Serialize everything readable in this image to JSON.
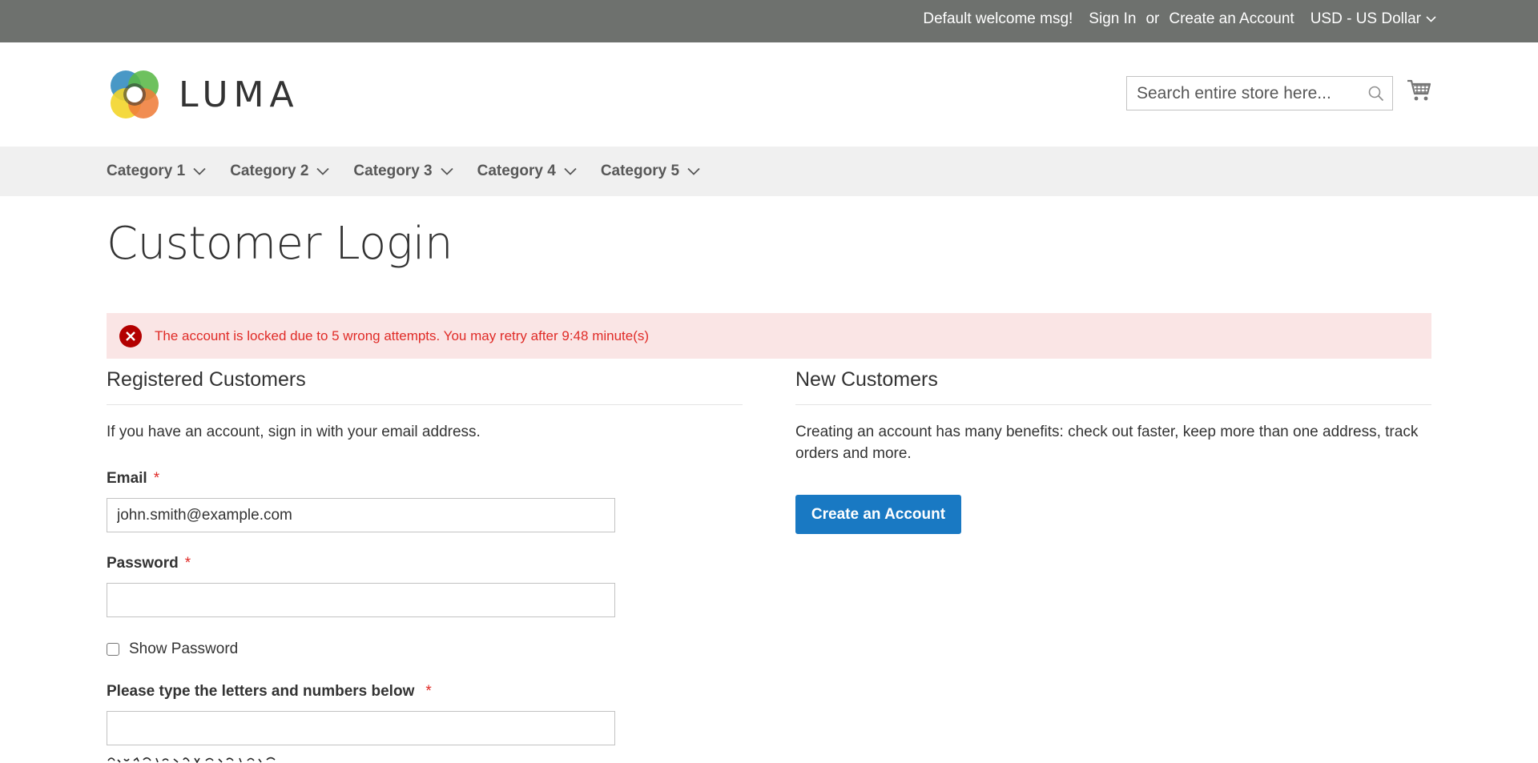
{
  "top_panel": {
    "welcome": "Default welcome msg!",
    "sign_in": "Sign In",
    "or": "or",
    "create_account": "Create an Account",
    "currency": "USD - US Dollar"
  },
  "header": {
    "logo_text": "LUMA",
    "search_placeholder": "Search entire store here...",
    "icons": [
      "search-icon",
      "cart-icon"
    ]
  },
  "nav": {
    "items": [
      {
        "label": "Category 1"
      },
      {
        "label": "Category 2"
      },
      {
        "label": "Category 3"
      },
      {
        "label": "Category 4"
      },
      {
        "label": "Category 5"
      }
    ]
  },
  "page": {
    "title": "Customer Login",
    "error_message": "The account is locked due to 5 wrong attempts. You may retry after 9:48 minute(s)"
  },
  "registered": {
    "title": "Registered Customers",
    "intro": "If you have an account, sign in with your email address.",
    "email_label": "Email",
    "email_value": "john.smith@example.com",
    "password_label": "Password",
    "password_value": "",
    "show_password_label": "Show Password",
    "captcha_label": "Please type the letters and numbers below",
    "captcha_value": "",
    "required_mark": "*"
  },
  "new_customers": {
    "title": "New Customers",
    "intro": "Creating an account has many benefits: check out faster, keep more than one address, track orders and more.",
    "button_label": "Create an Account"
  },
  "colors": {
    "top_bar": "#6e716e",
    "nav_bg": "#f0f0f0",
    "error_bg": "#fae5e5",
    "error_text": "#e02b27",
    "primary_button": "#1979c3"
  }
}
